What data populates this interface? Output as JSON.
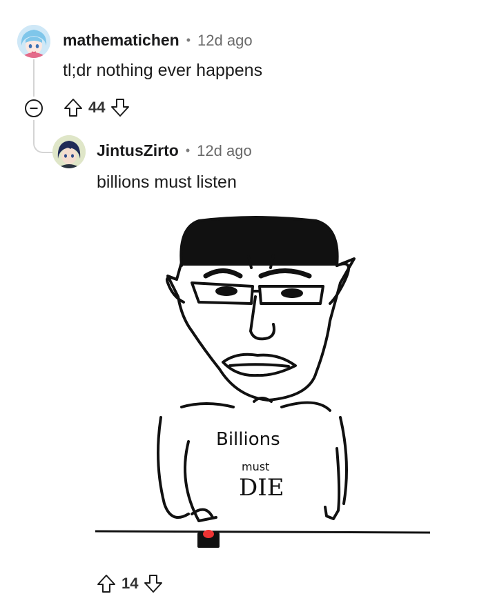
{
  "comments": [
    {
      "username": "mathematichen",
      "separator": "•",
      "time": "12d ago",
      "body": "tl;dr nothing ever happens",
      "score": "44",
      "avatar_icon": "anime-avatar-blue-hair"
    },
    {
      "username": "JintusZirto",
      "separator": "•",
      "time": "12d ago",
      "body": "billions must listen",
      "score": "14",
      "avatar_icon": "anime-avatar-dark-hair",
      "image": {
        "shirt_line1": "Billions",
        "shirt_line2": "must",
        "shirt_line3": "DIE"
      }
    }
  ],
  "icons": {
    "collapse": "collapse-minus-icon",
    "upvote": "upvote-arrow-icon",
    "downvote": "downvote-arrow-icon"
  },
  "colors": {
    "thread_line": "#d4d4d4",
    "avatar1_bg": "#cfe8f7",
    "avatar2_bg": "#dfe6c8"
  }
}
